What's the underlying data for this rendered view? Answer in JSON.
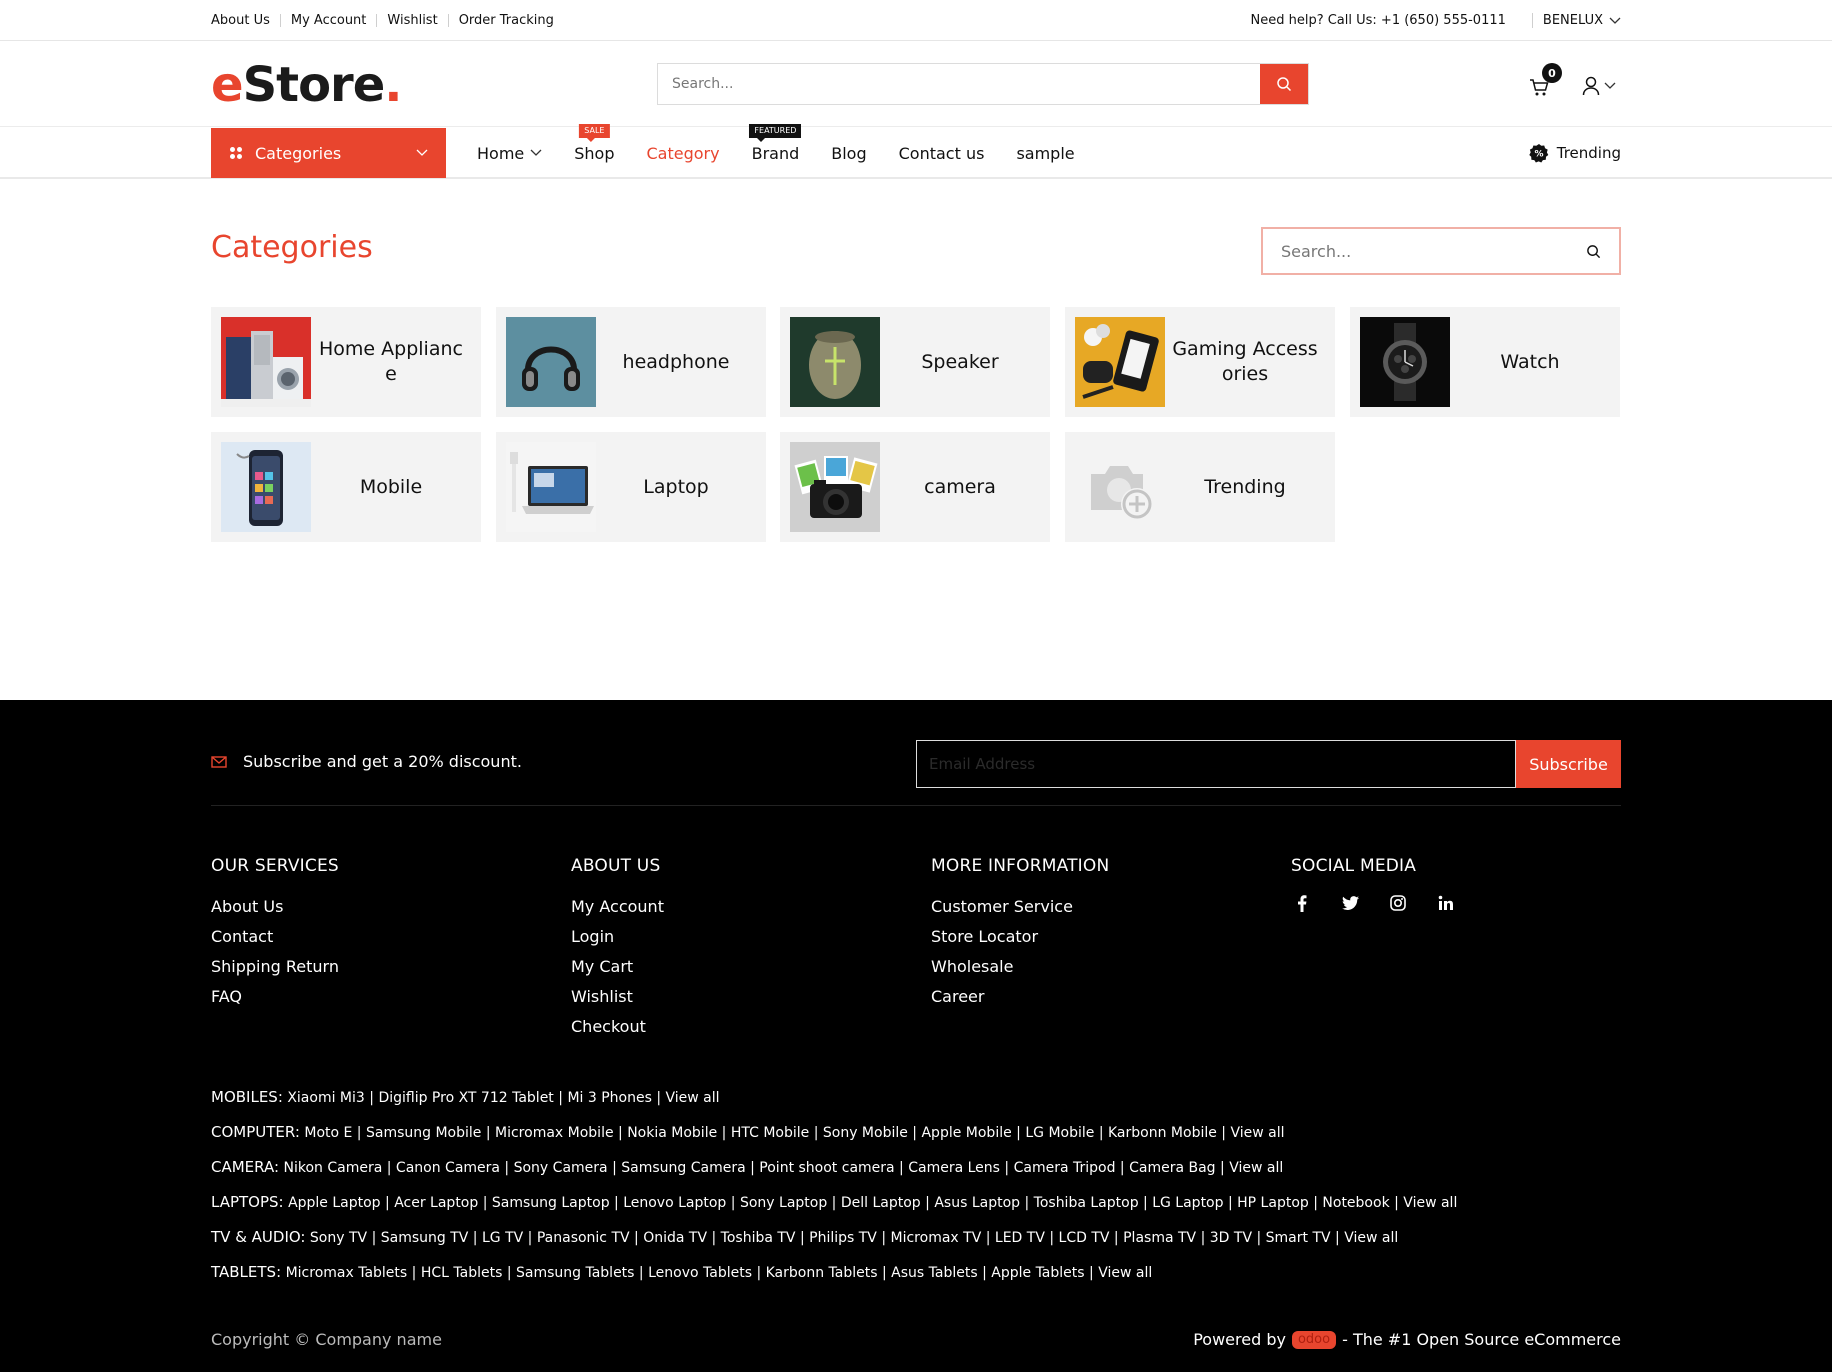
{
  "topbar": {
    "links": [
      "About Us",
      "My Account",
      "Wishlist",
      "Order Tracking"
    ],
    "help": "Need help? Call Us: +1 (650) 555-0111",
    "region": "BENELUX"
  },
  "header": {
    "logo_e": "e",
    "logo_text": "Store",
    "logo_dot": ".",
    "search_placeholder": "Search...",
    "cart_count": "0"
  },
  "nav": {
    "categories_label": "Categories",
    "items": [
      {
        "label": "Home",
        "tag": ""
      },
      {
        "label": "Shop",
        "tag": "SALE"
      },
      {
        "label": "Category",
        "tag": ""
      },
      {
        "label": "Brand",
        "tag": "FEATURED"
      },
      {
        "label": "Blog",
        "tag": ""
      },
      {
        "label": "Contact us",
        "tag": ""
      },
      {
        "label": "sample",
        "tag": ""
      }
    ],
    "trending_label": "Trending"
  },
  "page": {
    "title": "Categories",
    "search_placeholder": "Search..."
  },
  "categories": [
    {
      "label": "Home Appliance",
      "icon": "home-appliance-image"
    },
    {
      "label": "headphone",
      "icon": "headphone-image"
    },
    {
      "label": "Speaker",
      "icon": "speaker-image"
    },
    {
      "label": "Gaming Accessories",
      "icon": "gaming-accessories-image"
    },
    {
      "label": "Watch",
      "icon": "watch-image"
    },
    {
      "label": "Mobile",
      "icon": "mobile-image"
    },
    {
      "label": "Laptop",
      "icon": "laptop-image"
    },
    {
      "label": "camera",
      "icon": "camera-image"
    },
    {
      "label": "Trending",
      "icon": "placeholder-camera-image"
    }
  ],
  "footer": {
    "subscribe_text": "Subscribe and get a 20% discount.",
    "email_placeholder": "Email Address",
    "subscribe_button": "Subscribe",
    "columns": [
      {
        "title": "OUR SERVICES",
        "items": [
          "About Us",
          "Contact",
          "Shipping Return",
          "FAQ"
        ]
      },
      {
        "title": "ABOUT US",
        "items": [
          "My Account",
          "Login",
          "My Cart",
          "Wishlist",
          "Checkout"
        ]
      },
      {
        "title": "MORE INFORMATION",
        "items": [
          "Customer Service",
          "Store Locator",
          "Wholesale",
          "Career"
        ]
      }
    ],
    "social_title": "SOCIAL MEDIA",
    "social_icons": [
      "facebook-icon",
      "twitter-icon",
      "instagram-icon",
      "linkedin-icon"
    ],
    "link_rows": [
      {
        "head": "MOBILES:",
        "items": [
          "Xiaomi Mi3",
          "Digiflip Pro XT 712 Tablet",
          "Mi 3 Phones",
          "View all"
        ]
      },
      {
        "head": "COMPUTER:",
        "items": [
          "Moto E",
          "Samsung Mobile",
          "Micromax Mobile",
          "Nokia Mobile",
          "HTC Mobile",
          "Sony Mobile",
          "Apple Mobile",
          "LG Mobile",
          "Karbonn Mobile",
          "View all"
        ]
      },
      {
        "head": "CAMERA:",
        "items": [
          "Nikon Camera",
          "Canon Camera",
          "Sony Camera",
          "Samsung Camera",
          "Point shoot camera",
          "Camera Lens",
          "Camera Tripod",
          "Camera Bag",
          "View all"
        ]
      },
      {
        "head": "LAPTOPS:",
        "items": [
          "Apple Laptop",
          "Acer Laptop",
          "Samsung Laptop",
          "Lenovo Laptop",
          "Sony Laptop",
          "Dell Laptop",
          "Asus Laptop",
          "Toshiba Laptop",
          "LG Laptop",
          "HP Laptop",
          "Notebook",
          "View all"
        ]
      },
      {
        "head": "TV & AUDIO:",
        "items": [
          "Sony TV",
          "Samsung TV",
          "LG TV",
          "Panasonic TV",
          "Onida TV",
          "Toshiba TV",
          "Philips TV",
          "Micromax TV",
          "LED TV",
          "LCD TV",
          "Plasma TV",
          "3D TV",
          "Smart TV",
          "View all"
        ]
      },
      {
        "head": "TABLETS:",
        "items": [
          "Micromax Tablets",
          "HCL Tablets",
          "Samsung Tablets",
          "Lenovo Tablets",
          "Karbonn Tablets",
          "Asus Tablets",
          "Apple Tablets",
          "View all"
        ]
      }
    ],
    "copyright": "Copyright © Company name",
    "powered_prefix": "Powered by",
    "powered_brand": "odoo",
    "powered_suffix": "- The #1 Open Source eCommerce"
  },
  "colors": {
    "accent": "#e8452e",
    "footer_bg": "#000000",
    "card_bg": "#f3f3f3"
  }
}
